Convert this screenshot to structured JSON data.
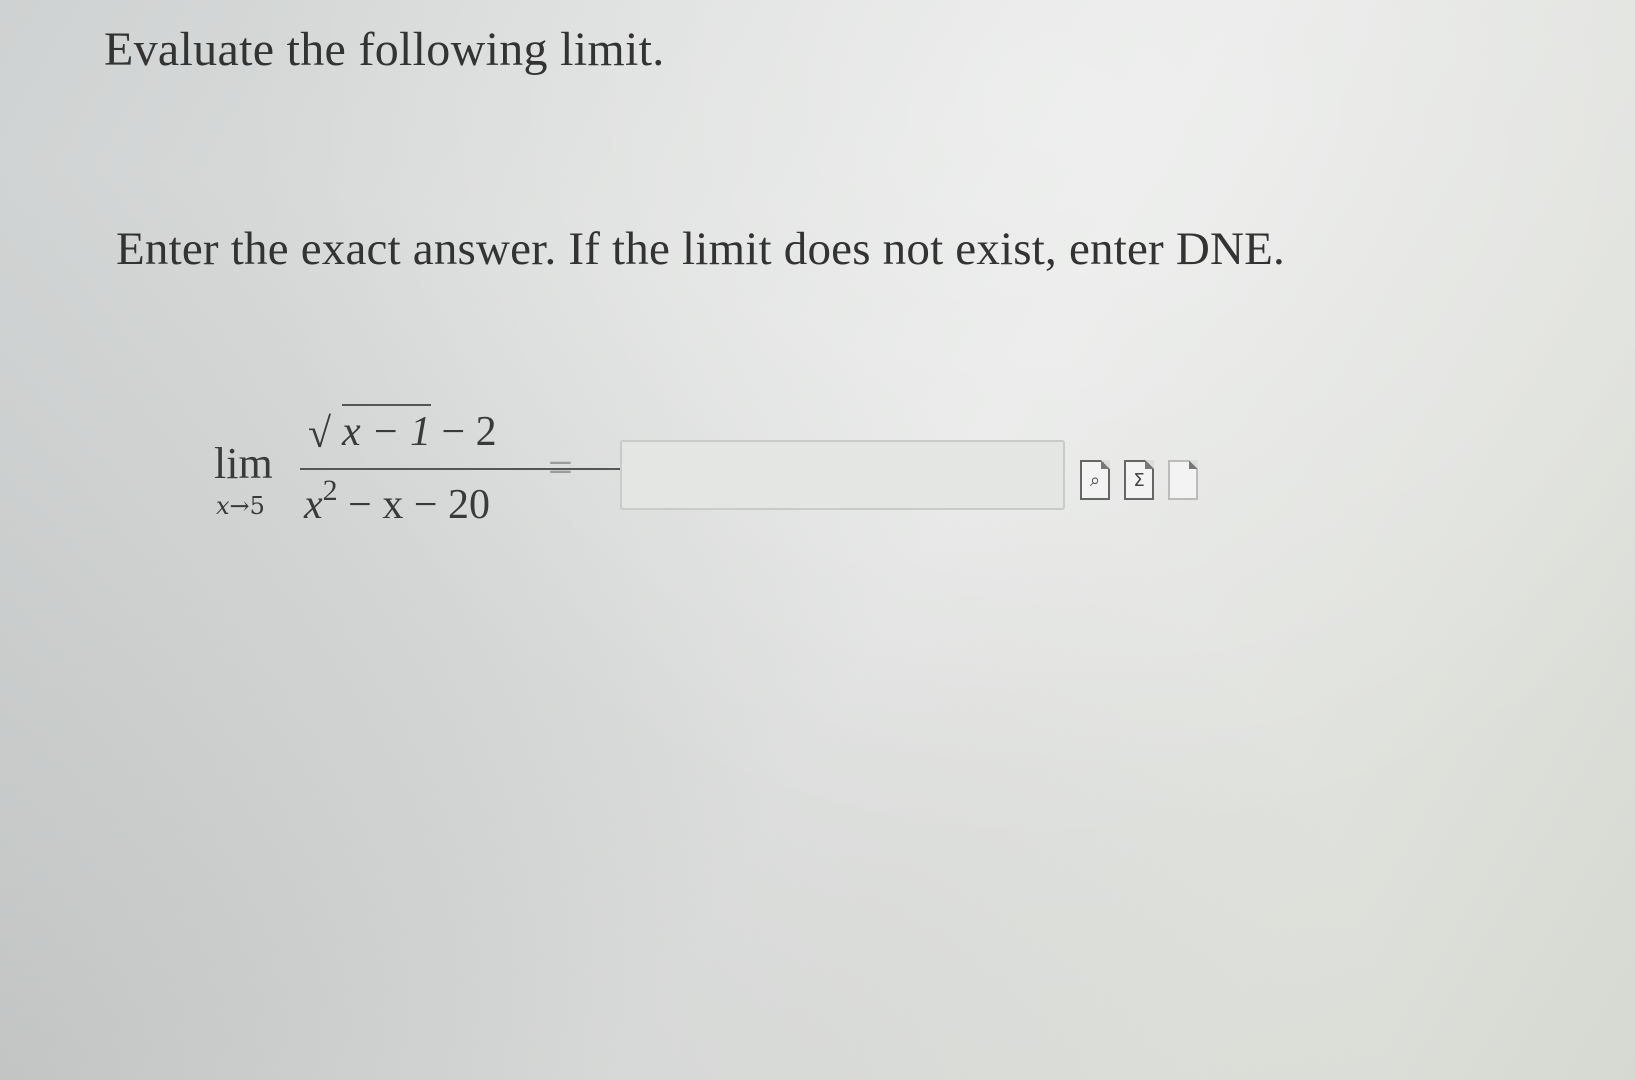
{
  "question": {
    "heading": "Evaluate the following limit.",
    "instruction": "Enter the exact answer. If the limit does not exist, enter DNE."
  },
  "expression": {
    "operator": "lim",
    "variable": "x",
    "approach": "→5",
    "numerator_radicand": "x − 1",
    "numerator_rest": " − 2",
    "denominator_base": "x",
    "denominator_power": "2",
    "denominator_rest": " − x − 20",
    "equals": "="
  },
  "answer": {
    "value": "",
    "placeholder": ""
  },
  "toolbar": {
    "preview_icon": "preview-icon",
    "equation_icon": "equation-editor-icon",
    "equation_symbol": "Σ",
    "help_icon": "help-icon"
  }
}
